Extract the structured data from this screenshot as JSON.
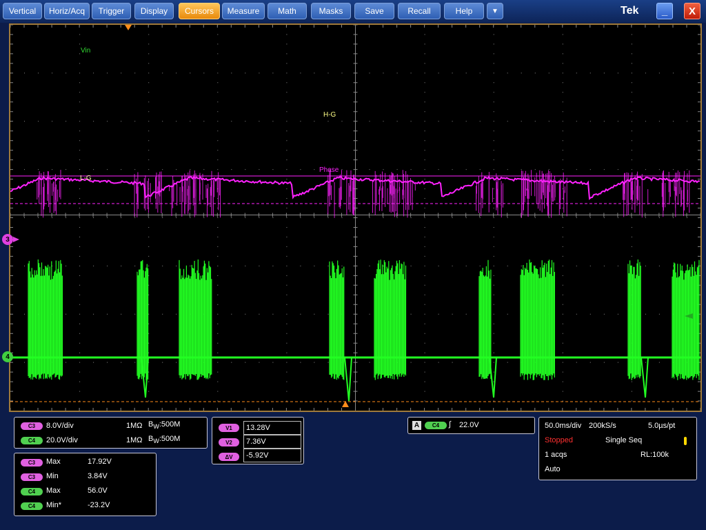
{
  "menu": {
    "items": [
      "Vertical",
      "Horiz/Acq",
      "Trigger",
      "Display",
      "Cursors",
      "Measure",
      "Math",
      "Masks",
      "Save",
      "Recall",
      "Help"
    ],
    "active": "Cursors",
    "dropdown_glyph": "▼",
    "brand": "Tek",
    "minimize_glyph": "_",
    "close_glyph": "X"
  },
  "screen": {
    "labels": {
      "vin": "Vin",
      "hg": "H-G",
      "lg": "L-G",
      "phase": "Phase"
    },
    "markers": {
      "ch3": "3",
      "ch4": "4"
    },
    "colors": {
      "ch3": "#ff22ff",
      "ch4": "#22ff22",
      "cursor": "#ff8c1a",
      "grid": "#8a8a8a",
      "label_yellow": "#ffff88",
      "label_green": "#33dd33"
    }
  },
  "channels": [
    {
      "tag": "C3",
      "scale": "8.0V/div",
      "impedance": "1MΩ",
      "bw_prefix": "B",
      "bw_sub": "W",
      "bw_value": ":500M"
    },
    {
      "tag": "C4",
      "scale": "20.0V/div",
      "impedance": "1MΩ",
      "bw_prefix": "B",
      "bw_sub": "W",
      "bw_value": ":500M"
    }
  ],
  "measurements": [
    {
      "tag": "C3",
      "name": "Max",
      "value": "17.92V"
    },
    {
      "tag": "C3",
      "name": "Min",
      "value": "3.84V"
    },
    {
      "tag": "C4",
      "name": "Max",
      "value": "56.0V"
    },
    {
      "tag": "C4",
      "name": "Min*",
      "value": "-23.2V"
    }
  ],
  "cursors": [
    {
      "label": "V1",
      "value": "13.28V"
    },
    {
      "label": "V2",
      "value": "7.36V"
    },
    {
      "label": "ΔV",
      "value": "-5.92V"
    }
  ],
  "trigger": {
    "mode_letter": "A",
    "source": "C4",
    "slope_glyph": "∫",
    "level": "22.0V"
  },
  "acquisition": {
    "timebase": "50.0ms/div",
    "sample_rate": "200kS/s",
    "resolution": "5.0µs/pt",
    "state": "Stopped",
    "mode": "Single Seq",
    "acqs": "1 acqs",
    "record_length": "RL:100k",
    "trigger_mode": "Auto"
  }
}
